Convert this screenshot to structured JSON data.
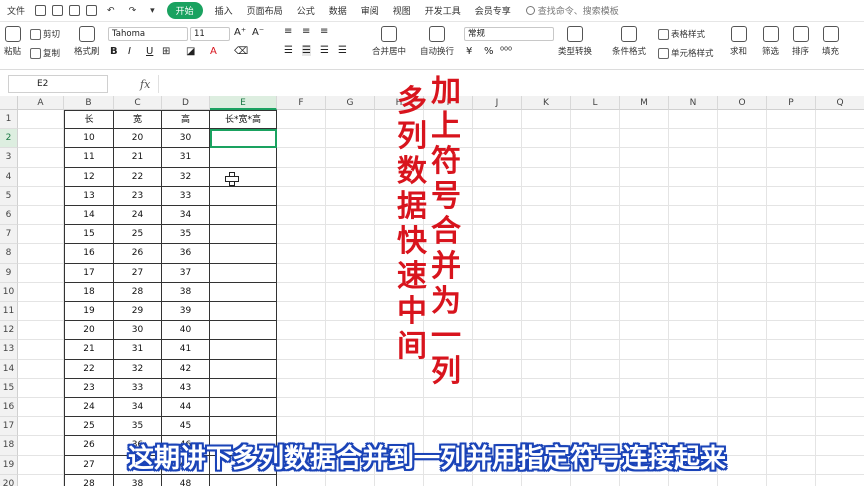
{
  "menubar": {
    "file": "文件",
    "start": "开始",
    "tabs": [
      "插入",
      "页面布局",
      "公式",
      "数据",
      "审阅",
      "视图",
      "开发工具",
      "会员专享"
    ],
    "search_placeholder": "查找命令、搜索模板"
  },
  "ribbon": {
    "paste": "粘贴",
    "cut": "剪切",
    "copy": "复制",
    "format_painter": "格式刷",
    "font_name": "Tahoma",
    "font_size": "11",
    "bold": "B",
    "italic": "I",
    "underline": "U",
    "merge_center": "合并居中",
    "wrap_text": "自动换行",
    "number_format": "常规",
    "type_convert": "类型转换",
    "cond_format": "条件格式",
    "table_style": "表格样式",
    "cell_style": "单元格样式",
    "sum": "求和",
    "filter": "筛选",
    "sort": "排序",
    "fill": "填充"
  },
  "formula_bar": {
    "name_box": "E2",
    "fx": "fx",
    "value": ""
  },
  "sheet": {
    "columns": [
      "A",
      "B",
      "C",
      "D",
      "E",
      "F",
      "G",
      "H",
      "I",
      "J",
      "K",
      "L",
      "M",
      "N",
      "O",
      "P",
      "Q"
    ],
    "rows": [
      "1",
      "2",
      "3",
      "4",
      "5",
      "6",
      "7",
      "8",
      "9",
      "10",
      "11",
      "12",
      "13",
      "14",
      "15",
      "16",
      "17",
      "18",
      "19",
      "20"
    ],
    "headers": [
      "长",
      "宽",
      "高",
      "长*宽*高"
    ],
    "data": [
      [
        "10",
        "20",
        "30"
      ],
      [
        "11",
        "21",
        "31"
      ],
      [
        "12",
        "22",
        "32"
      ],
      [
        "13",
        "23",
        "33"
      ],
      [
        "14",
        "24",
        "34"
      ],
      [
        "15",
        "25",
        "35"
      ],
      [
        "16",
        "26",
        "36"
      ],
      [
        "17",
        "27",
        "37"
      ],
      [
        "18",
        "28",
        "38"
      ],
      [
        "19",
        "29",
        "39"
      ],
      [
        "20",
        "30",
        "40"
      ],
      [
        "21",
        "31",
        "41"
      ],
      [
        "22",
        "32",
        "42"
      ],
      [
        "23",
        "33",
        "43"
      ],
      [
        "24",
        "34",
        "44"
      ],
      [
        "25",
        "35",
        "45"
      ],
      [
        "26",
        "36",
        "46"
      ],
      [
        "27",
        "37",
        "47"
      ],
      [
        "28",
        "38",
        "48"
      ]
    ],
    "active_cell": "E2"
  },
  "overlay": {
    "title_left": "多列数据快速中间",
    "title_right": "加上符号合并为一列",
    "subtitle": "这期讲下多列数据合并到一列并用指定符号连接起来",
    "title_color": "#d8141d",
    "subtitle_outline": "#1b44b8"
  },
  "colors": {
    "accent": "#1aa260"
  }
}
